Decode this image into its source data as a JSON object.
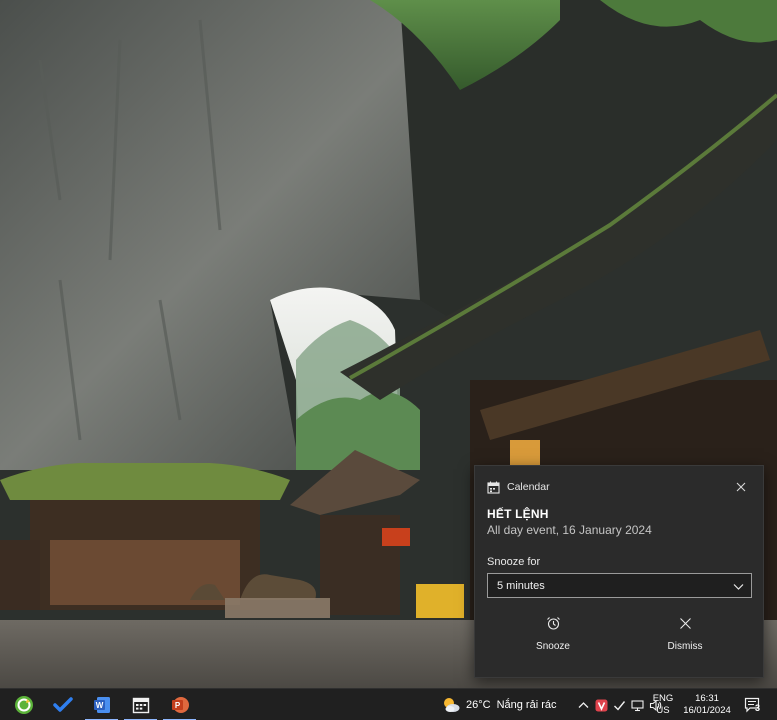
{
  "notification": {
    "app_name": "Calendar",
    "title": "HẾT LỆNH",
    "subtitle": "All day event, 16 January 2024",
    "snooze_label": "Snooze for",
    "snooze_selected": "5 minutes",
    "actions": {
      "snooze": "Snooze",
      "dismiss": "Dismiss"
    },
    "icons": {
      "app": "calendar-icon",
      "close": "close-icon",
      "snooze": "alarm-clock-icon",
      "dismiss": "close-icon"
    }
  },
  "taskbar": {
    "apps": [
      {
        "name": "recovery-app",
        "icon": "green-circle-arrow-icon",
        "running": false
      },
      {
        "name": "todo-app",
        "icon": "checkmark-icon",
        "running": false
      },
      {
        "name": "word-app",
        "icon": "word-icon",
        "running": true
      },
      {
        "name": "calendar-app",
        "icon": "calendar-icon",
        "running": true
      },
      {
        "name": "powerpoint-app",
        "icon": "powerpoint-icon",
        "running": true
      }
    ],
    "weather": {
      "temperature": "26°C",
      "condition": "Nắng rải rác",
      "icon": "partly-sunny-icon"
    },
    "tray_icons": [
      "chevron-up-icon",
      "vivaldi-icon",
      "security-check-icon",
      "network-icon",
      "volume-icon"
    ],
    "language": {
      "line1": "ENG",
      "line2": "US"
    },
    "clock": {
      "time": "16:31",
      "date": "16/01/2024"
    },
    "notifications": {
      "count": "3",
      "icon": "notification-center-icon"
    }
  },
  "colors": {
    "toast_bg": "#2b2b2b",
    "taskbar_bg": "#202020",
    "accent_word": "#2b5fbf",
    "accent_powerpoint": "#c43e1c",
    "todo_blue": "#2f7ff0"
  }
}
